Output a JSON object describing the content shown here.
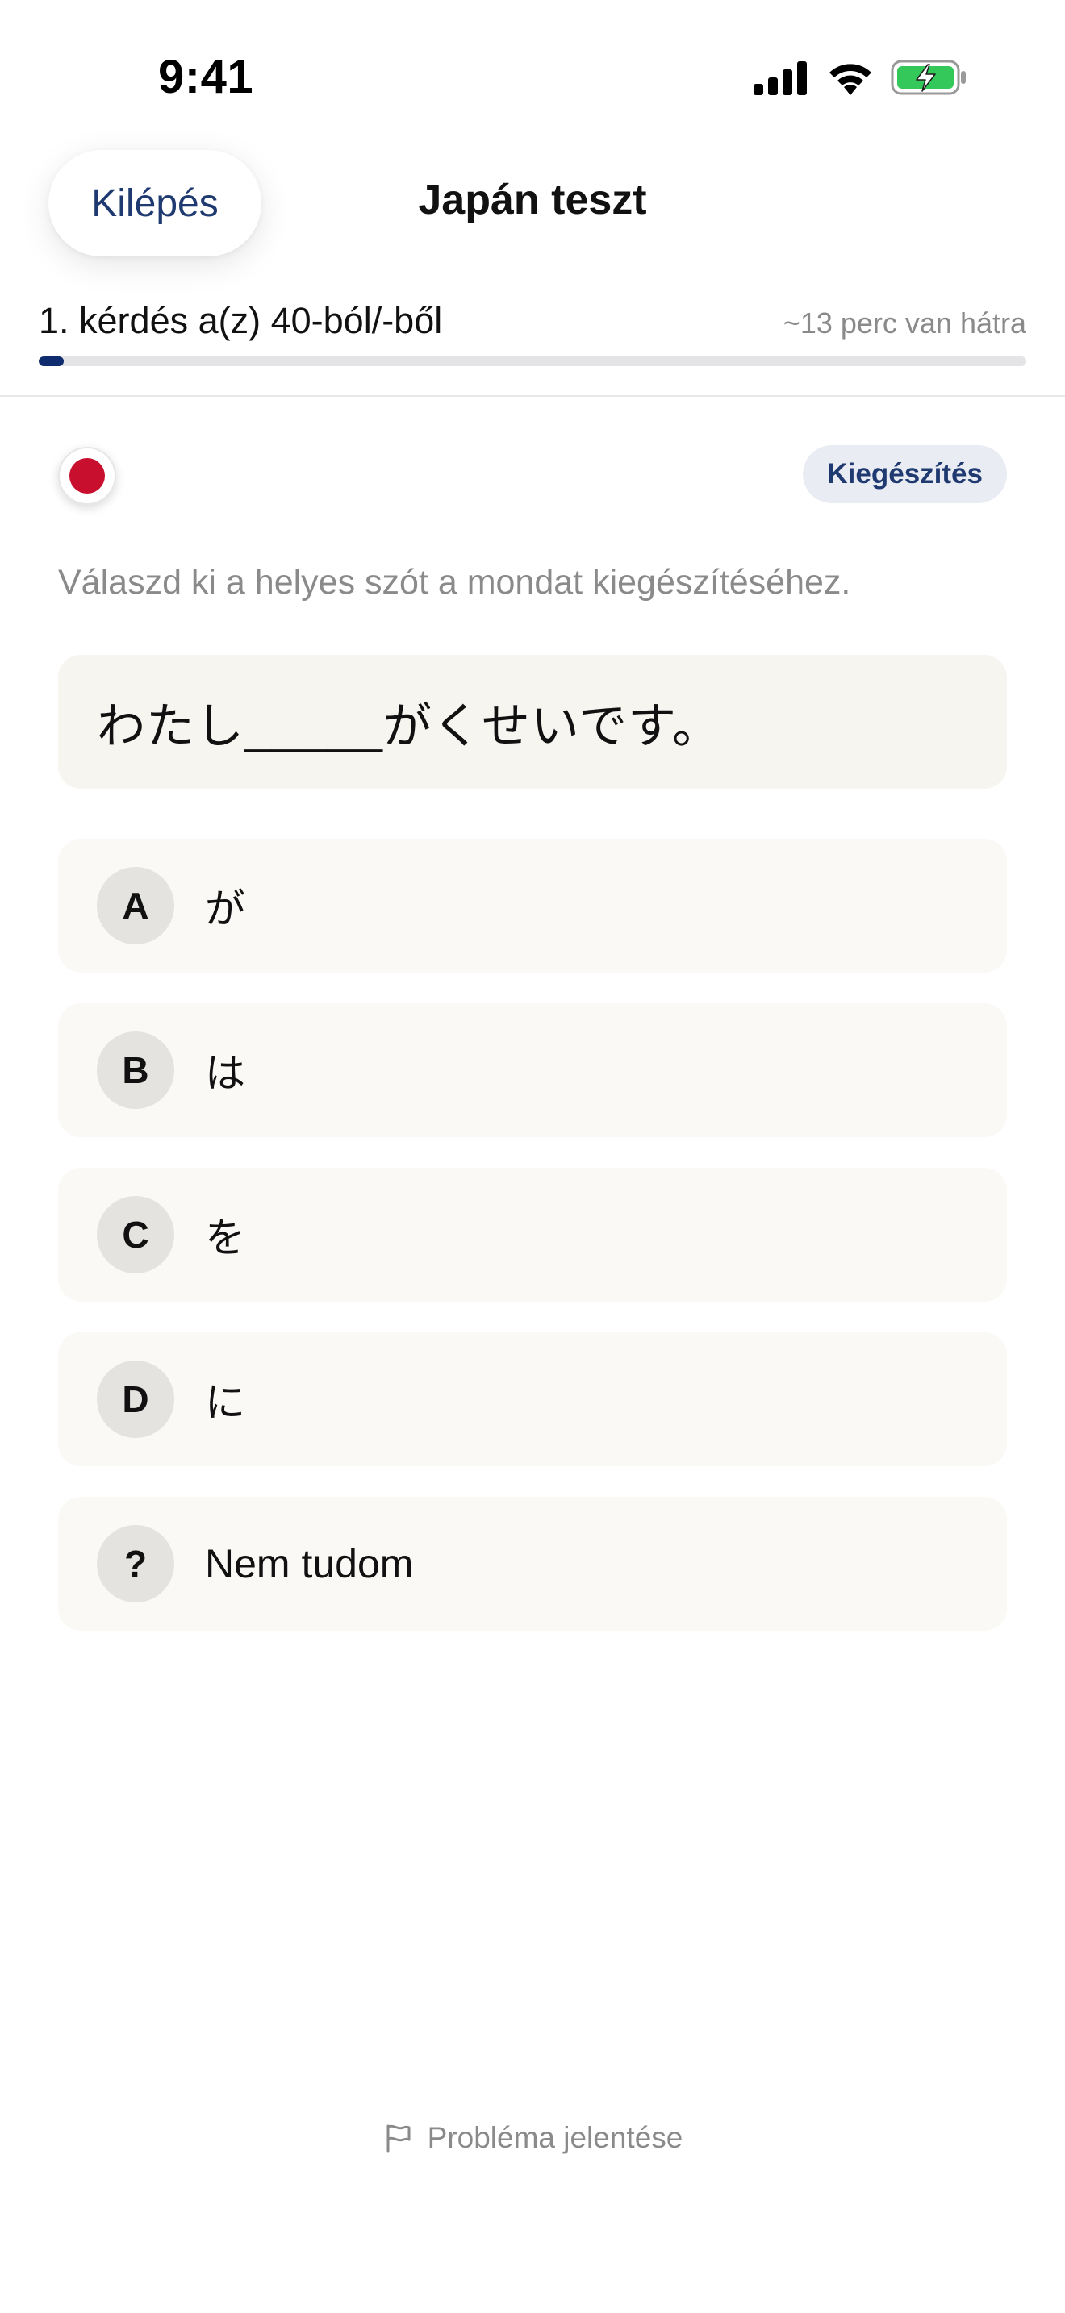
{
  "status_bar": {
    "time": "9:41"
  },
  "header": {
    "exit_label": "Kilépés",
    "title": "Japán teszt"
  },
  "progress": {
    "label": "1. kérdés a(z) 40-ból/-ből",
    "time_left": "~13 perc van hátra",
    "fraction": 0.025
  },
  "question": {
    "flag": "japan-flag-icon",
    "type_badge": "Kiegészítés",
    "instruction": "Válaszd ki a helyes szót a mondat kiegészítéséhez.",
    "sentence": "わたし_____がくせいです。"
  },
  "options": [
    {
      "letter": "A",
      "text": "が"
    },
    {
      "letter": "B",
      "text": "は"
    },
    {
      "letter": "C",
      "text": "を"
    },
    {
      "letter": "D",
      "text": "に"
    },
    {
      "letter": "?",
      "text": "Nem tudom"
    }
  ],
  "footer": {
    "report_label": "Probléma jelentése",
    "report_icon": "flag-outline-icon"
  },
  "colors": {
    "accent": "#0f2c6e",
    "exit_text": "#1f3a70",
    "battery_green": "#34c759",
    "flag_red": "#c8102e"
  }
}
